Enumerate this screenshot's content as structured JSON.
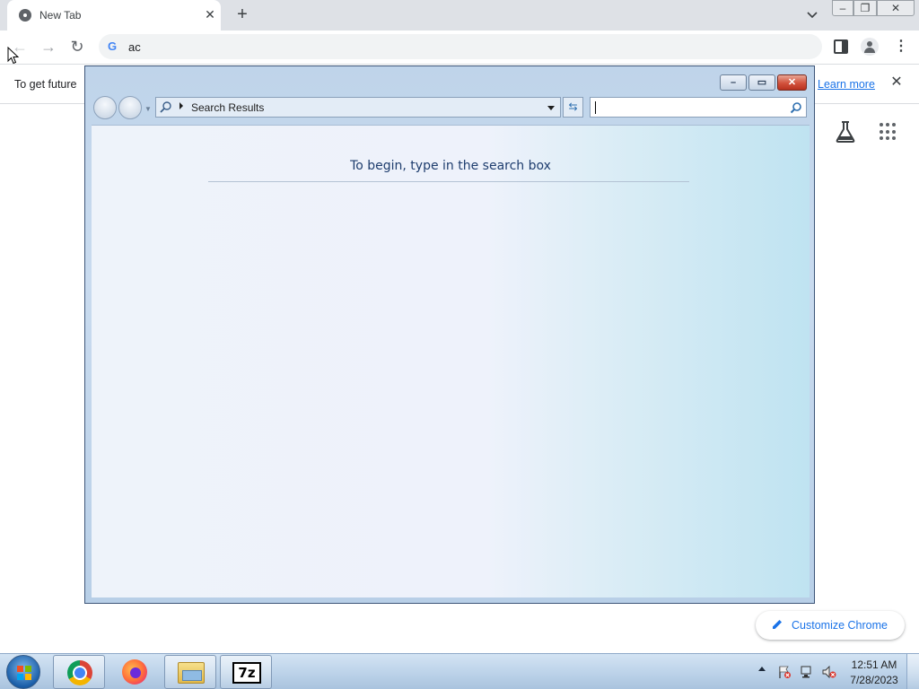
{
  "browser": {
    "tab": {
      "title": "New Tab"
    },
    "omnibox": {
      "value": "ac"
    },
    "infobar": {
      "text": "To get future",
      "link_label": "Learn more"
    },
    "ntp": {
      "customize_label": "Customize Chrome"
    },
    "icons": {
      "newtab": "+",
      "close": "✕",
      "menu": "⋮",
      "back": "←",
      "forward": "→",
      "reload": "↻"
    }
  },
  "search_window": {
    "address_text": "Search Results",
    "search_value": "",
    "hint": "To begin, type in the search box"
  },
  "taskbar": {
    "apps": [
      "Google Chrome",
      "Firefox",
      "Windows Explorer",
      "7-Zip"
    ],
    "sevenzip_label": "7z",
    "clock": {
      "time": "12:51 AM",
      "date": "7/28/2023"
    }
  },
  "colors": {
    "chrome_accent": "#1a73e8",
    "win7_close": "#d2513c",
    "hint_text": "#1e3d6e"
  }
}
